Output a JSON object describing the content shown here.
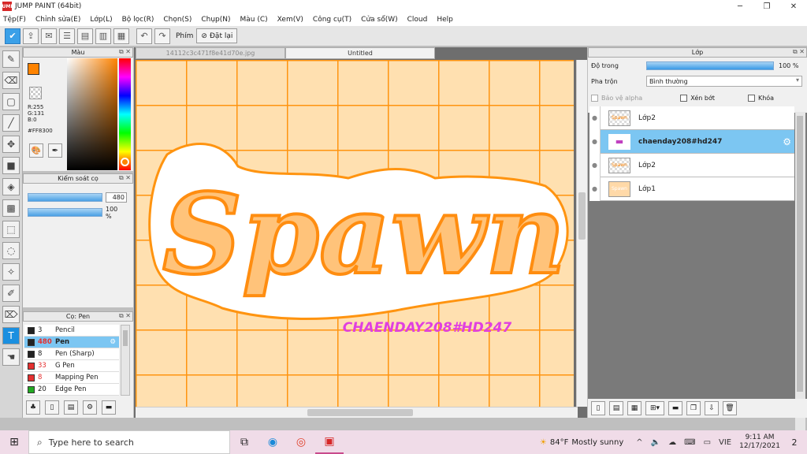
{
  "window": {
    "title": "JUMP PAINT (64bit)",
    "app_icon_label": "JUMP"
  },
  "menu": [
    "Tệp(F)",
    "Chỉnh sửa(E)",
    "Lớp(L)",
    "Bộ lọc(R)",
    "Chọn(S)",
    "Chụp(N)",
    "Màu (C)",
    "Xem(V)",
    "Công cụ(T)",
    "Cửa sổ(W)",
    "Cloud",
    "Help"
  ],
  "toolbar": {
    "keys_label": "Phím",
    "reset_label": "Đặt lại"
  },
  "color_panel": {
    "title": "Màu",
    "r": "R:255",
    "g": "G:131",
    "b": "B:0",
    "hex": "#FF8300",
    "fg_color": "#FF8300"
  },
  "brush_control": {
    "title": "Kiểm soát cọ",
    "size": "480",
    "opacity": "100 %"
  },
  "pen_panel": {
    "title": "Cọ: Pen",
    "items": [
      {
        "size": "3",
        "name": "Pencil",
        "color": "#222222"
      },
      {
        "size": "480",
        "name": "Pen",
        "color": "#222222",
        "selected": true
      },
      {
        "size": "8",
        "name": "Pen (Sharp)",
        "color": "#222222"
      },
      {
        "size": "33",
        "name": "G Pen",
        "color": "#e53030"
      },
      {
        "size": "8",
        "name": "Mapping Pen",
        "color": "#e53030"
      },
      {
        "size": "20",
        "name": "Edge Pen",
        "color": "#22aa22"
      }
    ]
  },
  "tabs": [
    {
      "label": "14112c3c471f8e41d70e.jpg",
      "active": false
    },
    {
      "label": "Untitled",
      "active": true
    }
  ],
  "artwork": {
    "main_word": "Spawn",
    "watermark": "CHAENDAY208#HD247",
    "bg_color": "#ffe0b0",
    "grid_color": "#ff9410",
    "letter_color": "#ffb04a",
    "watermark_color": "#e040e0"
  },
  "layer_panel": {
    "title": "Lớp",
    "opacity_label": "Độ trong",
    "opacity_value": "100 %",
    "opacity_fraction": 1.0,
    "blend_label": "Pha trộn",
    "blend_value": "Bình thường",
    "protect_alpha": "Bảo vệ alpha",
    "clipping": "Xén bớt",
    "lock": "Khóa",
    "layers": [
      {
        "name": "Lớp2",
        "thumb": "Spawn",
        "selected": false
      },
      {
        "name": "chaenday208#hd247",
        "thumb": "▬",
        "selected": true
      },
      {
        "name": "Lớp2",
        "thumb": "Spawn",
        "selected": false
      },
      {
        "name": "Lớp1",
        "thumb": "Spawn",
        "selected": false
      }
    ]
  },
  "taskbar": {
    "search_placeholder": "Type here to search",
    "weather_temp": "84°F",
    "weather_text": "Mostly sunny",
    "lang": "VIE",
    "time": "9:11 AM",
    "date": "12/17/2021",
    "notifications": "2"
  }
}
